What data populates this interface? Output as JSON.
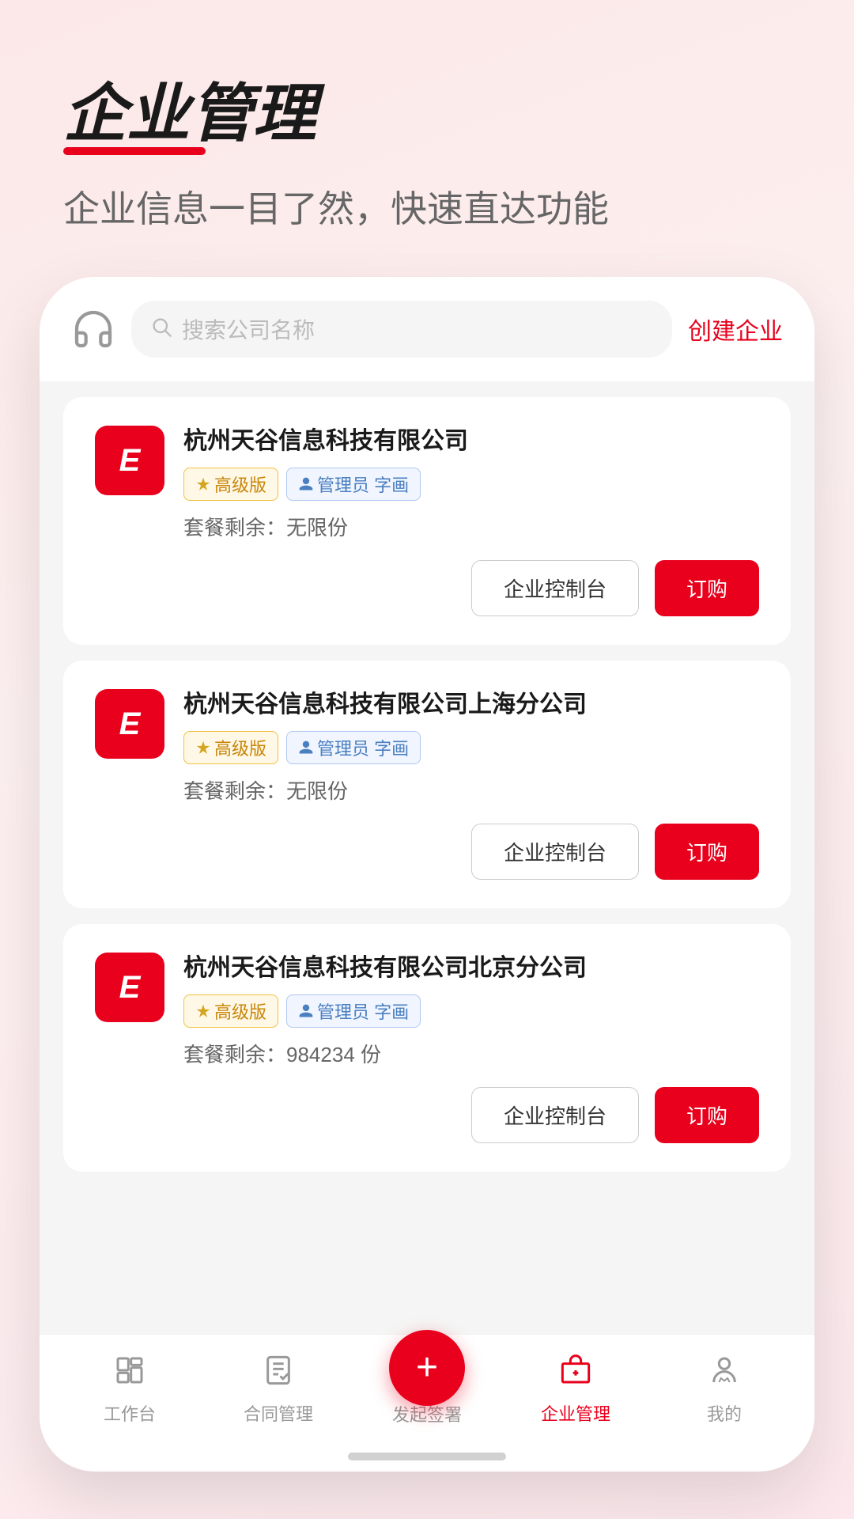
{
  "background": "#fce8e8",
  "header": {
    "title": "企业管理",
    "subtitle": "企业信息一目了然，快速直达功能"
  },
  "searchbar": {
    "placeholder": "搜索公司名称",
    "create_label": "创建企业"
  },
  "companies": [
    {
      "id": 1,
      "name": "杭州天谷信息科技有限公司",
      "logo_text": "E",
      "level_tag": "高级版",
      "admin_tag": "管理员 字画",
      "quota_label": "套餐剩余：",
      "quota_value": "无限份",
      "btn_control": "企业控制台",
      "btn_order": "订购"
    },
    {
      "id": 2,
      "name": "杭州天谷信息科技有限公司上海分公司",
      "logo_text": "E",
      "level_tag": "高级版",
      "admin_tag": "管理员 字画",
      "quota_label": "套餐剩余：",
      "quota_value": "无限份",
      "btn_control": "企业控制台",
      "btn_order": "订购"
    },
    {
      "id": 3,
      "name": "杭州天谷信息科技有限公司北京分公司",
      "logo_text": "E",
      "level_tag": "高级版",
      "admin_tag": "管理员 字画",
      "quota_label": "套餐剩余：",
      "quota_value": "984234 份",
      "btn_control": "企业控制台",
      "btn_order": "订购"
    }
  ],
  "bottom_nav": {
    "items": [
      {
        "id": "workbench",
        "label": "工作台",
        "active": false
      },
      {
        "id": "contract",
        "label": "合同管理",
        "active": false
      },
      {
        "id": "sign",
        "label": "发起签署",
        "active": false,
        "fab": true
      },
      {
        "id": "enterprise",
        "label": "企业管理",
        "active": true
      },
      {
        "id": "mine",
        "label": "我的",
        "active": false
      }
    ]
  },
  "icons": {
    "diamond": "♦",
    "person": "👤",
    "plus": "+",
    "search": "🔍",
    "headset": "🎧"
  }
}
